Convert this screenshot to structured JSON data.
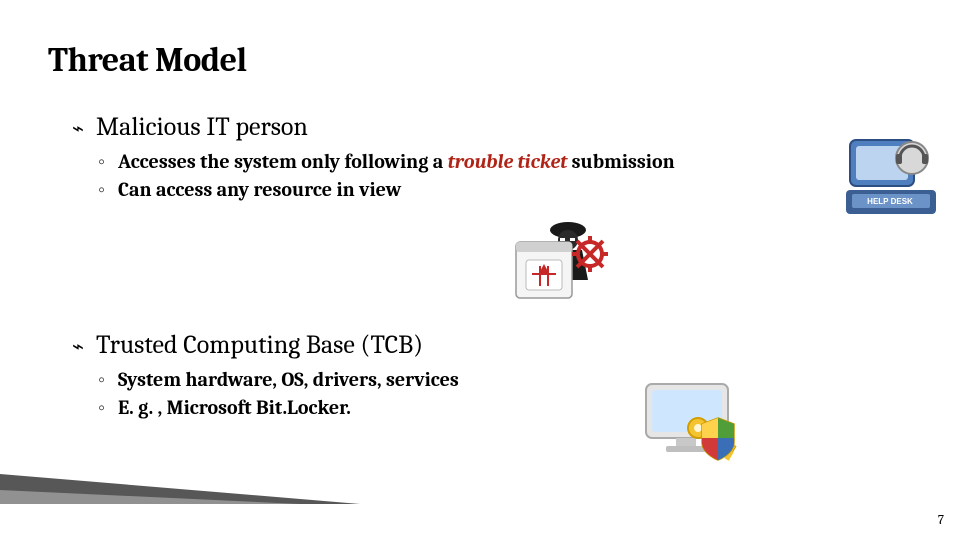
{
  "slide": {
    "title": "Threat Model",
    "page_number": "7",
    "bullets": {
      "main_marker": "⌁",
      "sub_marker": "◦"
    },
    "block1": {
      "heading": "Malicious IT person",
      "sub": {
        "line1_pre": "Accesses the system only following a ",
        "line1_em": "trouble ticket",
        "line1_post": " submission",
        "line2": "Can access any resource in view"
      }
    },
    "block2": {
      "heading": "Trusted Computing Base (TCB)",
      "sub": {
        "line1": "System hardware, OS, drivers, services",
        "line2": "E. g. , Microsoft Bit.Locker."
      }
    }
  },
  "icons": {
    "helpdesk": "help-desk-icon",
    "malware": "malicious-agent-icon",
    "tcb": "secure-computer-icon"
  }
}
